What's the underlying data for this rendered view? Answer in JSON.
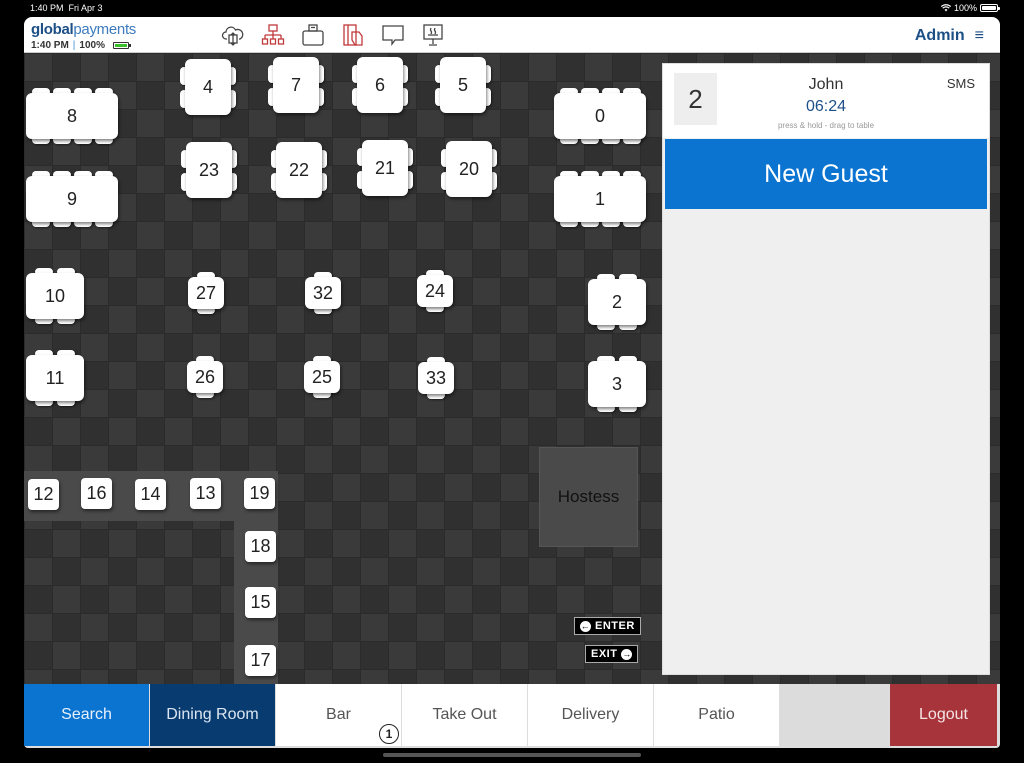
{
  "device_status": {
    "time": "1:40 PM",
    "date": "Fri Apr 3",
    "wifi_icon": "wifi-icon",
    "battery": "100%"
  },
  "header": {
    "logo_bold": "global",
    "logo_light": "payments",
    "time": "1:40 PM",
    "separator": "|",
    "battery": "100%",
    "user": "Admin",
    "menu_icon": "≡",
    "toolbar_icons": [
      "cloud-sync-icon",
      "network-icon",
      "printer-icon",
      "card-payment-icon",
      "chat-icon",
      "kitchen-display-icon"
    ]
  },
  "floor": {
    "tables": [
      {
        "id": "8"
      },
      {
        "id": "9"
      },
      {
        "id": "4"
      },
      {
        "id": "7"
      },
      {
        "id": "6"
      },
      {
        "id": "5"
      },
      {
        "id": "23"
      },
      {
        "id": "22"
      },
      {
        "id": "21"
      },
      {
        "id": "20"
      },
      {
        "id": "0"
      },
      {
        "id": "1"
      },
      {
        "id": "10"
      },
      {
        "id": "11"
      },
      {
        "id": "27"
      },
      {
        "id": "32"
      },
      {
        "id": "24"
      },
      {
        "id": "26"
      },
      {
        "id": "25"
      },
      {
        "id": "33"
      },
      {
        "id": "2"
      },
      {
        "id": "3"
      }
    ],
    "bar_seats": [
      "12",
      "16",
      "14",
      "13",
      "19",
      "18",
      "15",
      "17"
    ],
    "hostess_label": "Hostess",
    "enter_label": "ENTER",
    "exit_label": "EXIT",
    "enter_arrow": "←",
    "exit_arrow": "→"
  },
  "waitlist": {
    "guest": {
      "party_size": "2",
      "name": "John",
      "wait_time": "06:24",
      "hint": "press & hold - drag to table",
      "contact": "SMS"
    },
    "new_guest_label": "New Guest"
  },
  "bottom_tabs": {
    "search": "Search",
    "dining_room": "Dining Room",
    "bar": "Bar",
    "bar_badge": "1",
    "take_out": "Take Out",
    "delivery": "Delivery",
    "patio": "Patio",
    "logout": "Logout"
  },
  "colors": {
    "brand_blue": "#0b74d1",
    "active_tab": "#083b70",
    "logout_red": "#a8343b",
    "header_text": "#1d4f87"
  }
}
